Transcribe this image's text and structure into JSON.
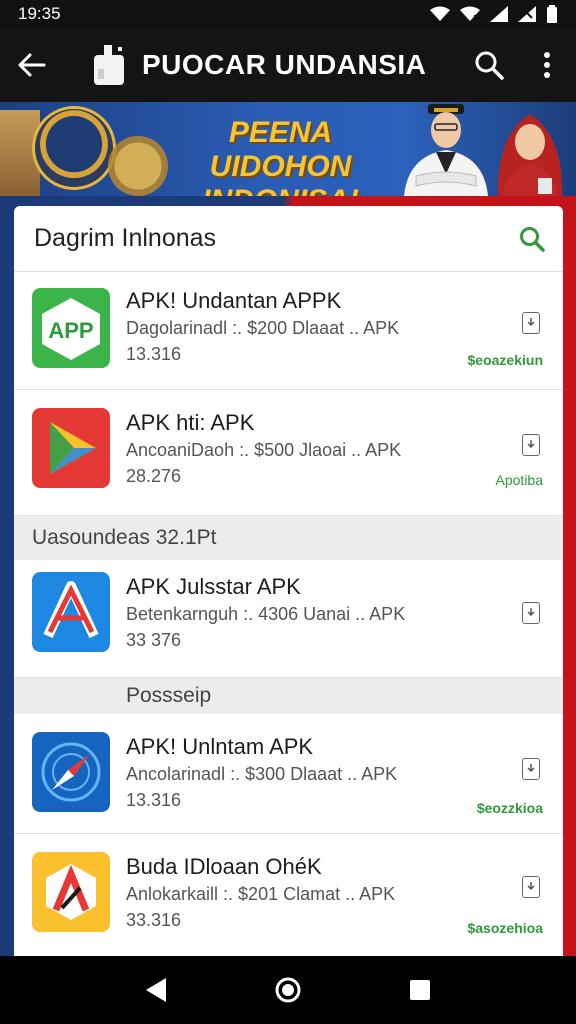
{
  "status_bar": {
    "time": "19:35"
  },
  "app_bar": {
    "title": "PUOCAR UNDANSIA"
  },
  "banner": {
    "line1": "PEENA UIDOHON",
    "line2": "INDONISA!"
  },
  "list_header": {
    "title": "Dagrim Inlnonas"
  },
  "sections": [
    {
      "label": "Uasoundeas 32.1Pt"
    },
    {
      "label": "Possseip"
    }
  ],
  "apps": [
    {
      "name": "APK! Undantan APPK",
      "desc": "Dagolarinadl :. $200 Dlaaat .. APK",
      "size": "13.316",
      "price": "$eoazekiun",
      "icon_text": "APP"
    },
    {
      "name": "APK hti: APK",
      "desc": "AncoaniDaoh :. $500 Jlaoai .. APK",
      "size": "28.276",
      "price": "Apotiba"
    },
    {
      "name": "APK Julsstar APK",
      "desc": "Betenkarnguh :. 4306 Uanai .. APK",
      "size": "33 376",
      "price": ""
    },
    {
      "name": "APK! Unlntam APK",
      "desc": "Ancolarinadl :. $300 Dlaaat .. APK",
      "size": "13.316",
      "price": "$eozzkioa"
    },
    {
      "name": "Buda IDloaan OhéK",
      "desc": "Anlokarkaill :. $201 Clamat .. APK",
      "size": "33.316",
      "price": "$asozehioa"
    }
  ]
}
